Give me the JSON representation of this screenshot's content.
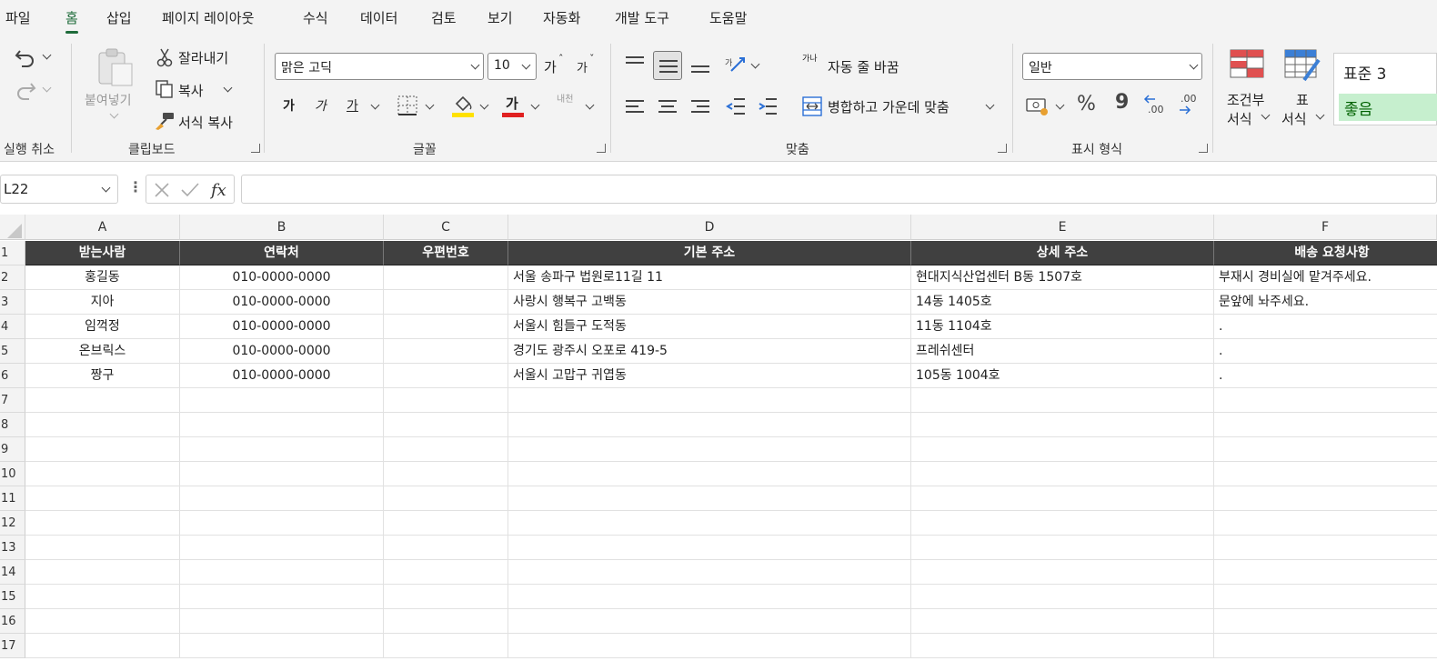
{
  "tabs": [
    "파일",
    "홈",
    "삽입",
    "페이지 레이아웃",
    "수식",
    "데이터",
    "검토",
    "보기",
    "자동화",
    "개발 도구",
    "도움말"
  ],
  "groups": {
    "undo": "실행 취소",
    "clipboard": "클립보드",
    "font": "글꼴",
    "alignment": "맞춤",
    "number": "표시 형식"
  },
  "clipboard": {
    "paste": "붙여넣기",
    "cut": "잘라내기",
    "copy": "복사",
    "format_painter": "서식 복사"
  },
  "font": {
    "name": "맑은 고딕",
    "size": "10",
    "grow": "가",
    "shrink": "가",
    "bold": "가",
    "italic": "가",
    "underline": "가",
    "color_letter": "가",
    "phonetic": "내천"
  },
  "alignment": {
    "wrap": "자동 줄 바꿈",
    "merge": "병합하고 가운데 맞춤",
    "wrap_glyph": "가나"
  },
  "number": {
    "format": "일반",
    "percent": "%",
    "comma": "9",
    "inc": ".00",
    "dec": ".00"
  },
  "styles": {
    "cond_1": "조건부",
    "cond_2": "서식",
    "table_1": "표",
    "table_2": "서식",
    "style1": "표준 3",
    "style2": "좋음"
  },
  "namebox": "L22",
  "colors": {
    "accent": "#1e6b3a",
    "header_fill": "#404040",
    "good_fill": "#c6efce",
    "good_text": "#006100",
    "fill_yellow": "#ffe100",
    "font_red": "#e02020"
  },
  "columns": [
    "A",
    "B",
    "C",
    "D",
    "E",
    "F"
  ],
  "rows": [
    "1",
    "2",
    "3",
    "4",
    "5",
    "6",
    "7",
    "8",
    "9",
    "10",
    "11",
    "12",
    "13",
    "14",
    "15",
    "16",
    "17"
  ],
  "headers": [
    "받는사람",
    "연락처",
    "우편번호",
    "기본 주소",
    "상세 주소",
    "배송 요청사항"
  ],
  "data": [
    [
      "홍길동",
      "010-0000-0000",
      "",
      "서울 송파구 법원로11길 11",
      "현대지식산업센터 B동 1507호",
      "부재시 경비실에 맡겨주세요."
    ],
    [
      "지아",
      "010-0000-0000",
      "",
      "사랑시 행복구 고백동",
      "14동 1405호",
      "문앞에 놔주세요."
    ],
    [
      "임꺽정",
      "010-0000-0000",
      "",
      "서울시 힘들구 도적동",
      "11동 1104호",
      "."
    ],
    [
      "온브릭스",
      "010-0000-0000",
      "",
      "경기도 광주시 오포로 419-5",
      "프레쉬센터",
      "."
    ],
    [
      "짱구",
      "010-0000-0000",
      "",
      "서울시 고맙구 귀엽동",
      "105동 1004호",
      "."
    ]
  ]
}
